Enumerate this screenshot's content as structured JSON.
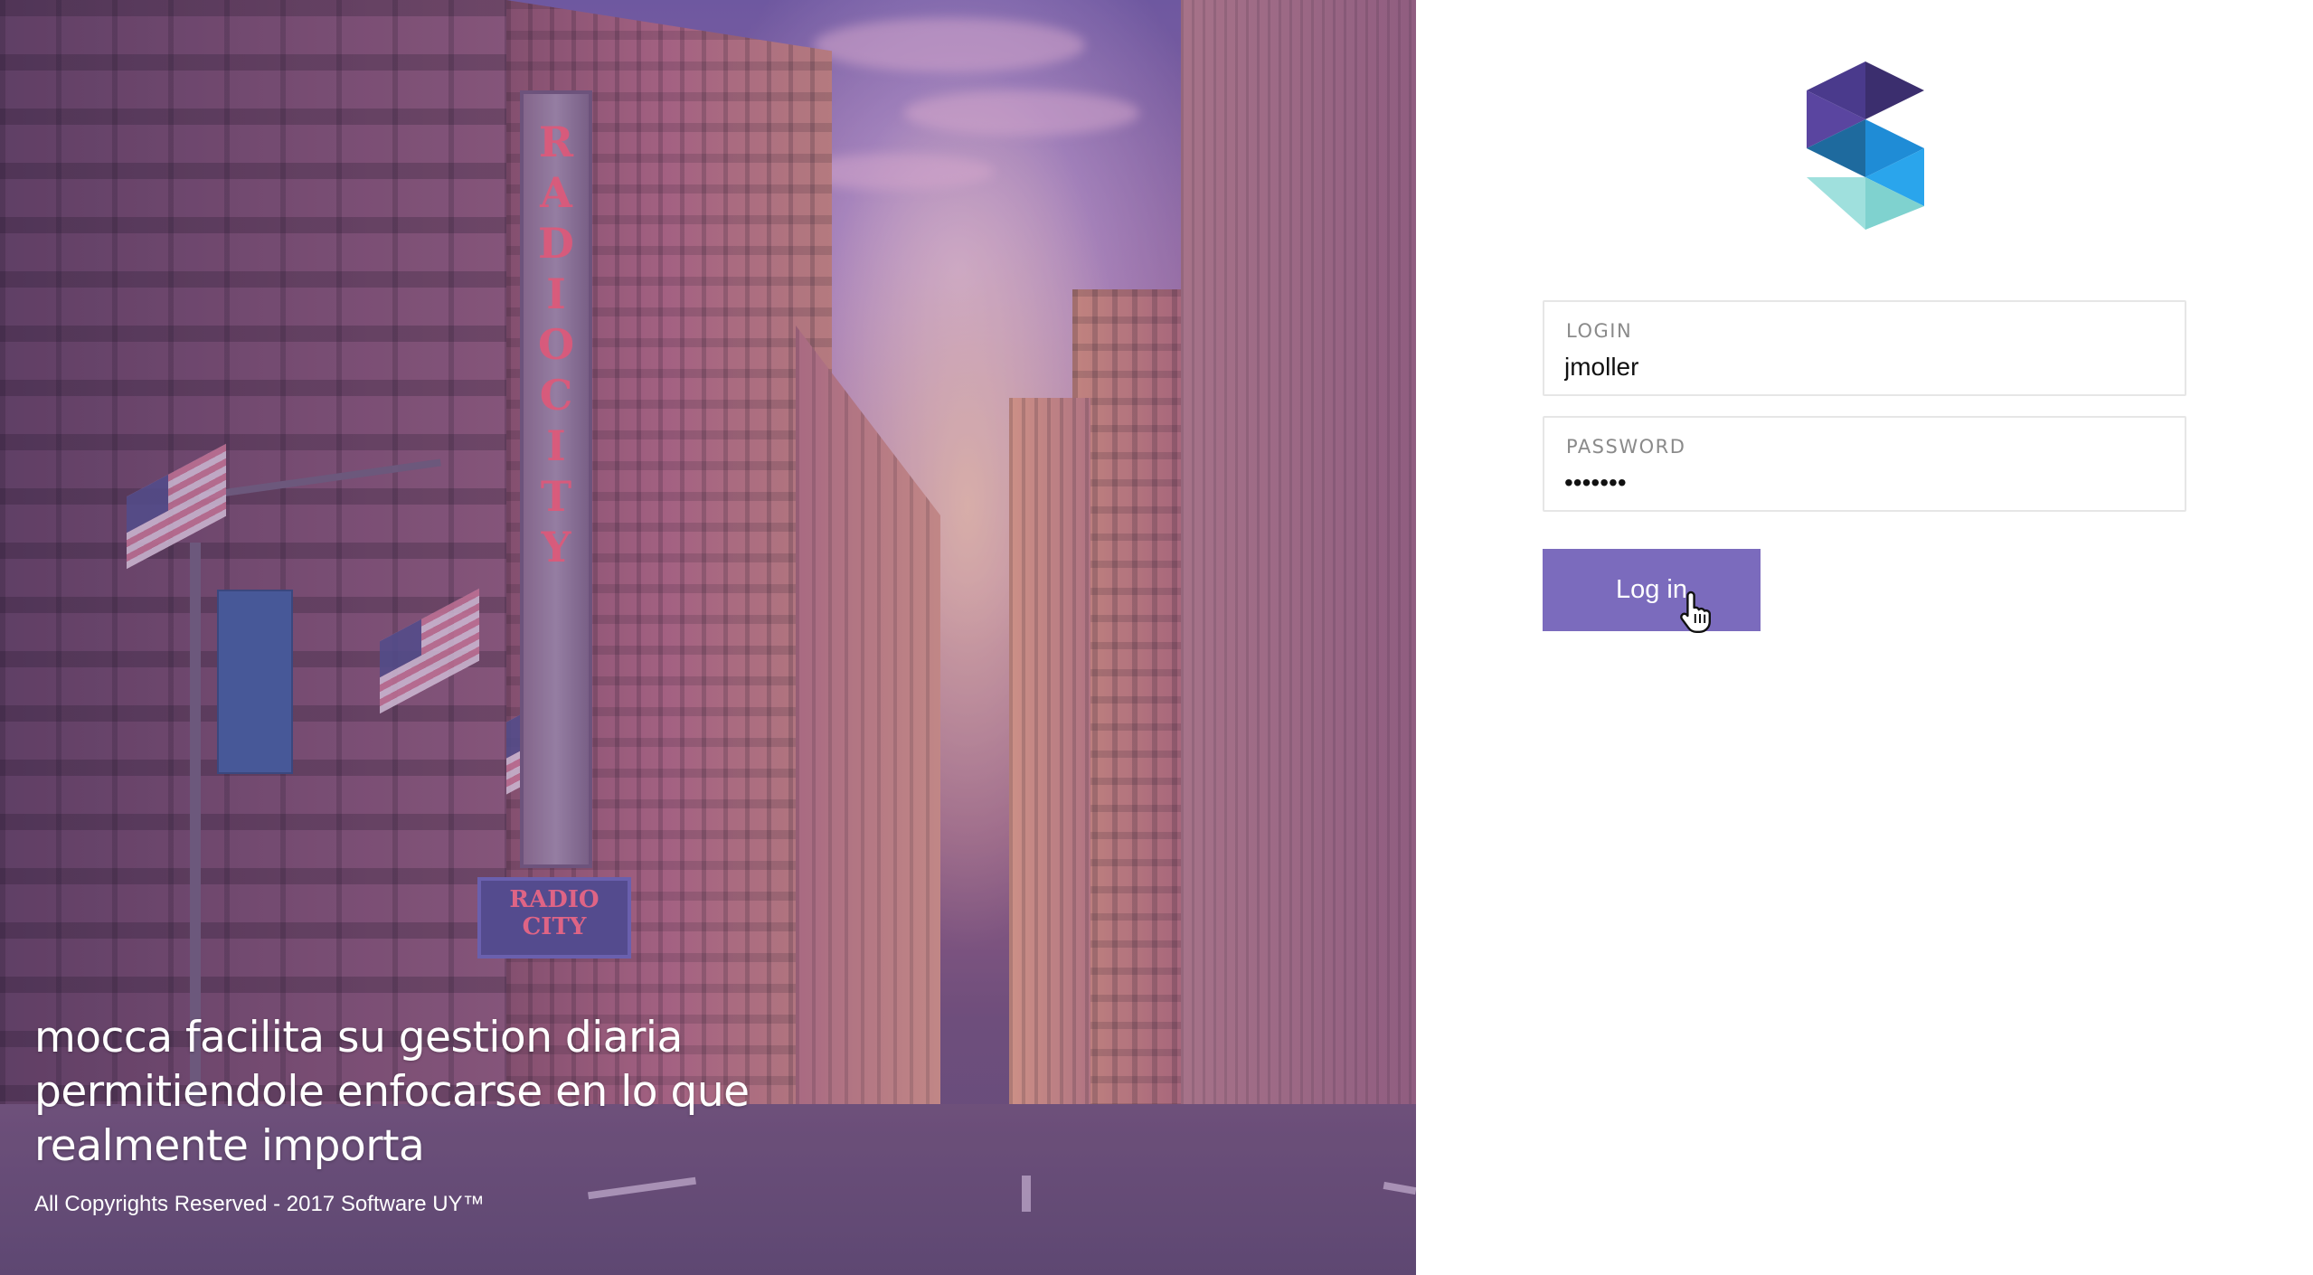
{
  "hero": {
    "tagline": "mocca facilita su gestion diaria permitiendole enfocarse en lo que realmente importa",
    "copyright": "All Copyrights Reserved - 2017 Software UY™",
    "sign_letters": [
      "R",
      "A",
      "D",
      "I",
      "O",
      "C",
      "I",
      "T",
      "Y"
    ],
    "marquee_text": "RADIO CITY",
    "overlay_color": "#6e50a0"
  },
  "logo": {
    "icon": "mocca-logo-icon",
    "colors": [
      "#3b2e6e",
      "#5a45a0",
      "#1e6a9e",
      "#2aa5ec",
      "#7fd2cf"
    ]
  },
  "login_form": {
    "login_label": "LOGIN",
    "login_value": "jmoller",
    "password_label": "PASSWORD",
    "password_value": "•••••••",
    "submit_label": "Log in",
    "accent_color": "#7b6bbd"
  },
  "cursor": {
    "icon": "hand-pointer-icon"
  }
}
